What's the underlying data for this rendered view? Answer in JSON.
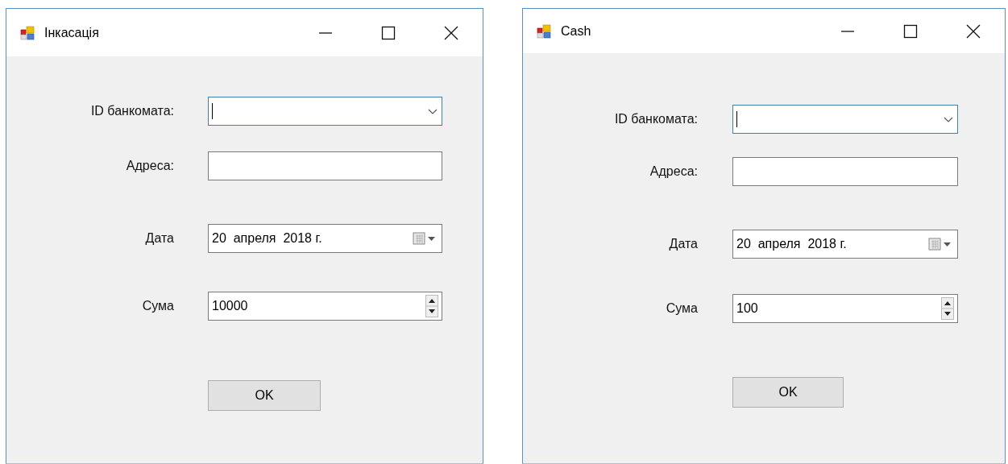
{
  "windows": [
    {
      "title": "Інкасація",
      "fields": [
        {
          "kind": "combo",
          "label": "ID банкомата:",
          "focused": true
        },
        {
          "kind": "text",
          "label": "Адреса:",
          "focused": false
        },
        {
          "kind": "date",
          "label": "Дата",
          "value": "20  апреля  2018 г.",
          "focused": false
        },
        {
          "kind": "numeric",
          "label": "Сума",
          "value": "10000",
          "focused": false
        }
      ],
      "button": "OK"
    },
    {
      "title": "Cash",
      "fields": [
        {
          "kind": "combo",
          "label": "ID банкомата:",
          "focused": true
        },
        {
          "kind": "text",
          "label": "Адреса:",
          "focused": false
        },
        {
          "kind": "date",
          "label": "Дата",
          "value": "20  апреля  2018 г.",
          "focused": false
        },
        {
          "kind": "numeric",
          "label": "Сума",
          "value": "100",
          "focused": false
        }
      ],
      "button": "OK"
    }
  ]
}
